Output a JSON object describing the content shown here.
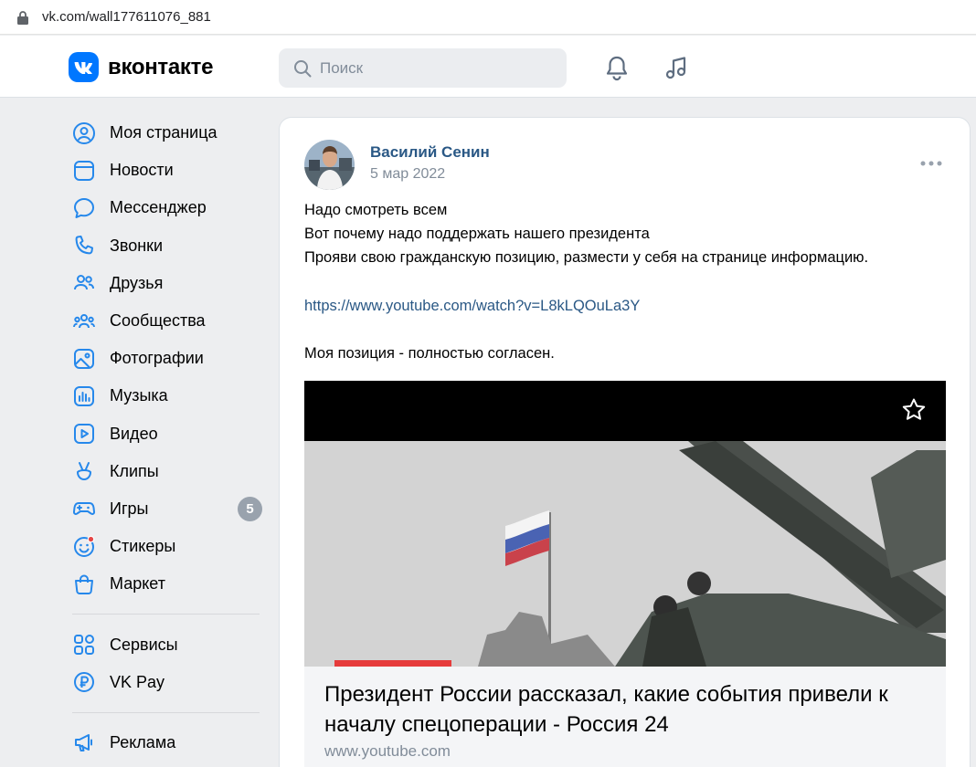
{
  "browser": {
    "url": "vk.com/wall177611076_881"
  },
  "header": {
    "logo_text": "вконтакте",
    "search_placeholder": "Поиск"
  },
  "nav": {
    "items": [
      {
        "label": "Моя страница",
        "icon": "user-circle-icon"
      },
      {
        "label": "Новости",
        "icon": "newsfeed-icon"
      },
      {
        "label": "Мессенджер",
        "icon": "message-icon"
      },
      {
        "label": "Звонки",
        "icon": "phone-icon"
      },
      {
        "label": "Друзья",
        "icon": "friends-icon"
      },
      {
        "label": "Сообщества",
        "icon": "communities-icon"
      },
      {
        "label": "Фотографии",
        "icon": "photos-icon"
      },
      {
        "label": "Музыка",
        "icon": "music-icon"
      },
      {
        "label": "Видео",
        "icon": "video-icon"
      },
      {
        "label": "Клипы",
        "icon": "clips-icon"
      },
      {
        "label": "Игры",
        "icon": "games-icon",
        "badge": "5"
      },
      {
        "label": "Стикеры",
        "icon": "stickers-icon"
      },
      {
        "label": "Маркет",
        "icon": "market-icon"
      }
    ],
    "secondary": [
      {
        "label": "Сервисы",
        "icon": "services-icon"
      },
      {
        "label": "VK Pay",
        "icon": "vkpay-icon"
      }
    ],
    "tertiary": [
      {
        "label": "Реклама",
        "icon": "ads-icon"
      }
    ]
  },
  "post": {
    "author": "Василий Сенин",
    "date": "5 мар 2022",
    "lines": [
      "Надо смотреть всем",
      "Вот почему надо поддержать нашего президента",
      "Прояви свою гражданскую позицию, размести у себя на странице информацию."
    ],
    "link": "https://www.youtube.com/watch?v=L8kLQOuLa3Y",
    "footer_line": "Моя позиция - полностью согласен.",
    "attachment": {
      "title": "Президент России рассказал, какие события привели к началу спецоперации - Россия 24",
      "domain": "www.youtube.com"
    }
  },
  "colors": {
    "brand": "#0077ff",
    "link": "#2a5885",
    "secondary_text": "#818c99",
    "background": "#edeef0"
  }
}
